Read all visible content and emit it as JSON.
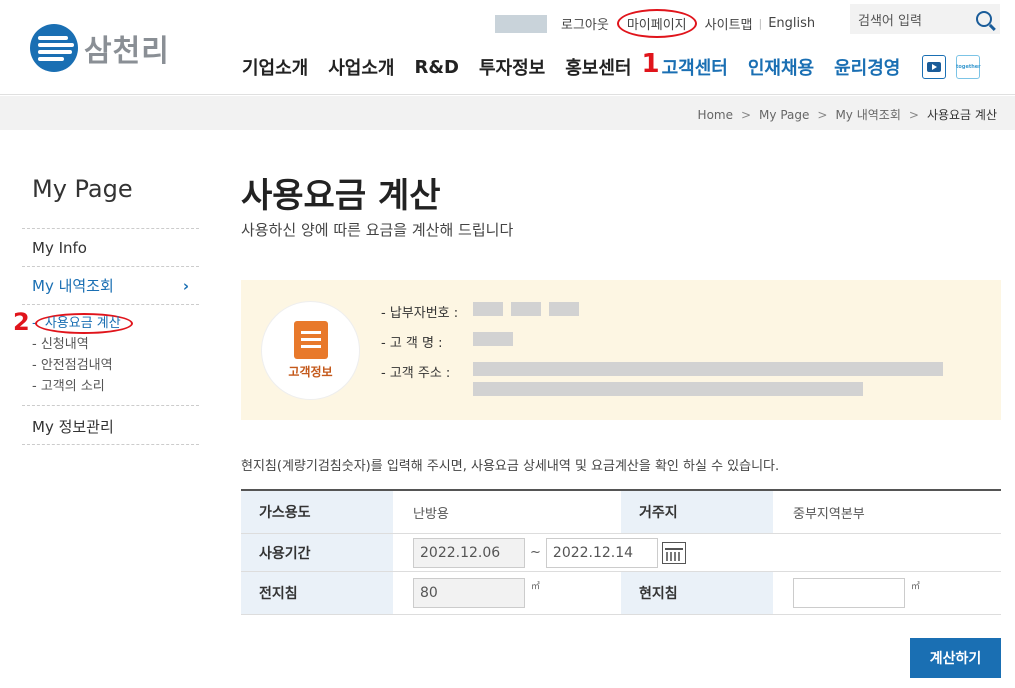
{
  "brand": {
    "name": "삼천리",
    "logo_color": "#1a6fb3"
  },
  "util": {
    "logout": "로그아웃",
    "mypage": "마이페이지",
    "sitemap": "사이트맵",
    "english": "English",
    "search_placeholder": "검색어 입력"
  },
  "gnb": {
    "items": [
      "기업소개",
      "사업소개",
      "R&D",
      "투자정보",
      "홍보센터",
      "고객센터",
      "인재채용",
      "윤리경영"
    ],
    "annotation_1": "1"
  },
  "breadcrumb": [
    "Home",
    "My Page",
    "My 내역조회",
    "사용요금 계산"
  ],
  "lnb": {
    "title": "My Page",
    "my_info": "My Info",
    "history": "My 내역조회",
    "sub": [
      "사용요금 계산",
      "신청내역",
      "안전점검내역",
      "고객의 소리"
    ],
    "profile": "My 정보관리",
    "annotation_2": "2"
  },
  "main": {
    "title": "사용요금 계산",
    "desc": "사용하신 양에 따른 요금을 계산해 드립니다",
    "info_label": "고객정보",
    "payer_no_label": "- 납부자번호 :",
    "customer_name_label": "- 고  객  명 :",
    "address_label": "- 고객  주소 :",
    "notice": "현지침(계량기검침숫자)를 입력해 주시면, 사용요금 상세내역 및 요금계산을 확인 하실 수 있습니다."
  },
  "form": {
    "gas_use_label": "가스용도",
    "gas_use_value": "난방용",
    "region_label": "거주지",
    "region_value": "중부지역본부",
    "period_label": "사용기간",
    "period_from": "2022.12.06",
    "period_sep": "~",
    "period_to": "2022.12.14",
    "prev_label": "전지침",
    "prev_value": "80",
    "unit": "㎥",
    "curr_label": "현지침",
    "curr_value": "",
    "submit": "계산하기"
  }
}
